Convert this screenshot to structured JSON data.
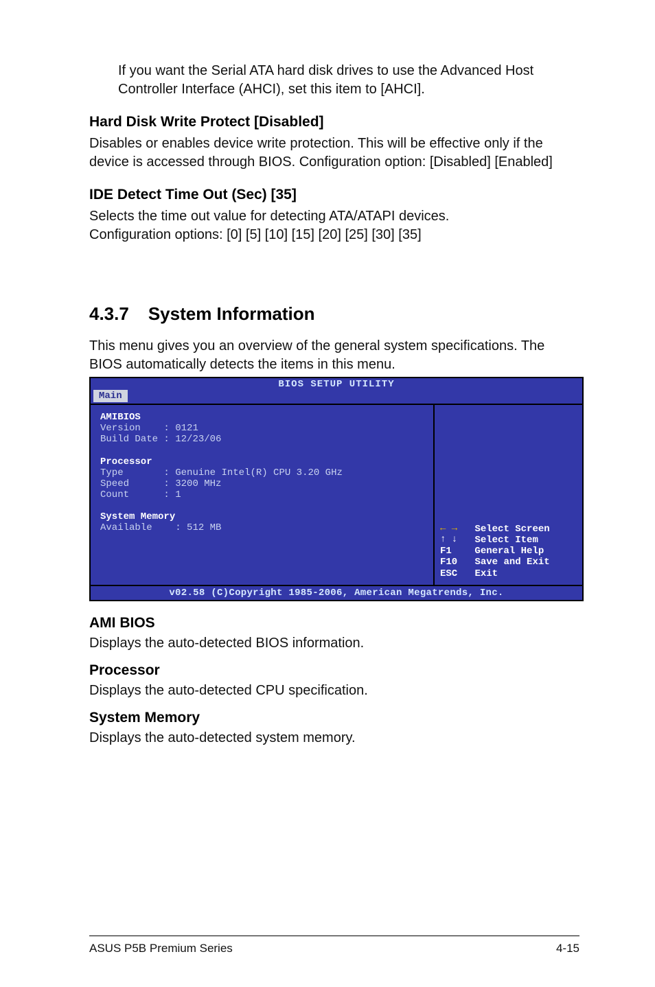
{
  "intro": "If you want the Serial ATA hard disk drives to use the Advanced Host Controller Interface (AHCI), set this item to [AHCI].",
  "hardDisk": {
    "title": "Hard Disk Write Protect [Disabled]",
    "body": "Disables or enables device write protection. This will be effective only if the device is accessed through BIOS. Configuration option: [Disabled] [Enabled]"
  },
  "ideDetect": {
    "title": "IDE Detect Time Out (Sec) [35]",
    "line1": "Selects the time out value for detecting ATA/ATAPI devices.",
    "line2": "Configuration options: [0] [5] [10] [15] [20] [25] [30] [35]"
  },
  "section": {
    "num": "4.3.7",
    "title": "System Information",
    "body": "This menu gives you an overview of the general system specifications. The BIOS automatically detects the items in this menu."
  },
  "bios": {
    "titlebar": "BIOS SETUP UTILITY",
    "tab": "Main",
    "amibios": {
      "heading": "AMIBIOS",
      "versionLabel": "Version",
      "versionValue": "0121",
      "buildLabel": "Build Date",
      "buildValue": "12/23/06"
    },
    "processor": {
      "heading": "Processor",
      "typeLabel": "Type",
      "typeValue": "Genuine Intel(R) CPU 3.20 GHz",
      "speedLabel": "Speed",
      "speedValue": "3200 MHz",
      "countLabel": "Count",
      "countValue": "1"
    },
    "memory": {
      "heading": "System Memory",
      "availLabel": "Available",
      "availValue": "512 MB"
    },
    "help": {
      "selectScreen": "Select Screen",
      "selectItem": "Select Item",
      "f1Key": "F1",
      "f1Label": "General Help",
      "f10Key": "F10",
      "f10Label": "Save and Exit",
      "escKey": "ESC",
      "escLabel": "Exit"
    },
    "footer": "v02.58 (C)Copyright 1985-2006, American Megatrends, Inc."
  },
  "amiBios": {
    "title": "AMI BIOS",
    "body": "Displays the auto-detected BIOS information."
  },
  "processorSection": {
    "title": "Processor",
    "body": "Displays the auto-detected CPU specification."
  },
  "sysMemSection": {
    "title": "System Memory",
    "body": "Displays the auto-detected system memory."
  },
  "footer": {
    "left": "ASUS P5B Premium Series",
    "right": "4-15"
  }
}
